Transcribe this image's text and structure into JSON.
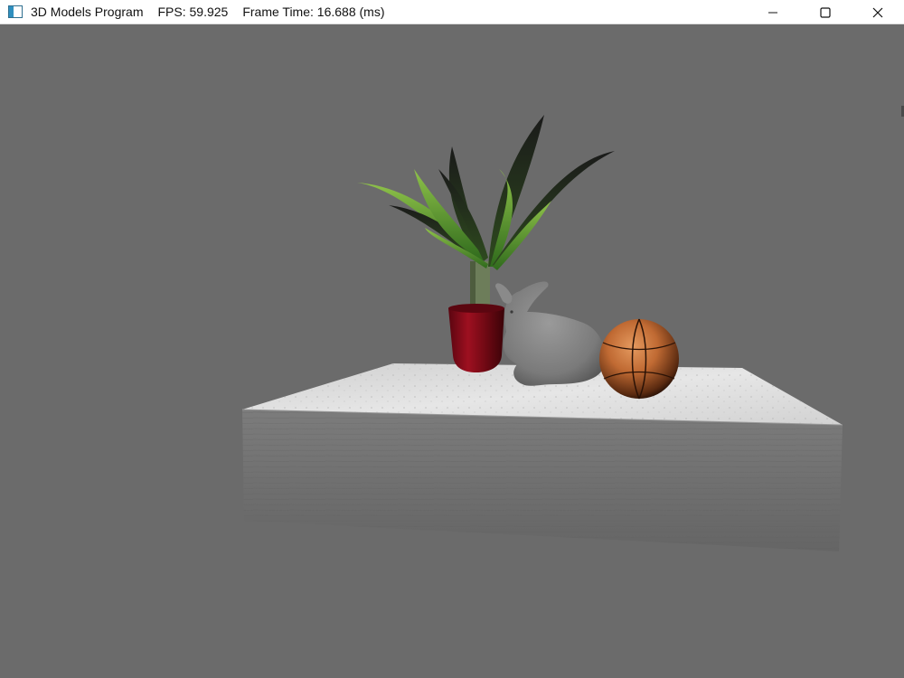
{
  "window": {
    "title": "3D Models Program",
    "fps": "FPS: 59.925",
    "frame_time": "Frame Time: 16.688 (ms)",
    "controls": {
      "minimize_icon": "minimize-icon",
      "maximize_icon": "maximize-icon",
      "close_icon": "close-icon"
    }
  },
  "scene": {
    "background_color": "#6b6b6b",
    "objects": [
      "table",
      "potted-plant",
      "bunny",
      "basketball"
    ]
  }
}
